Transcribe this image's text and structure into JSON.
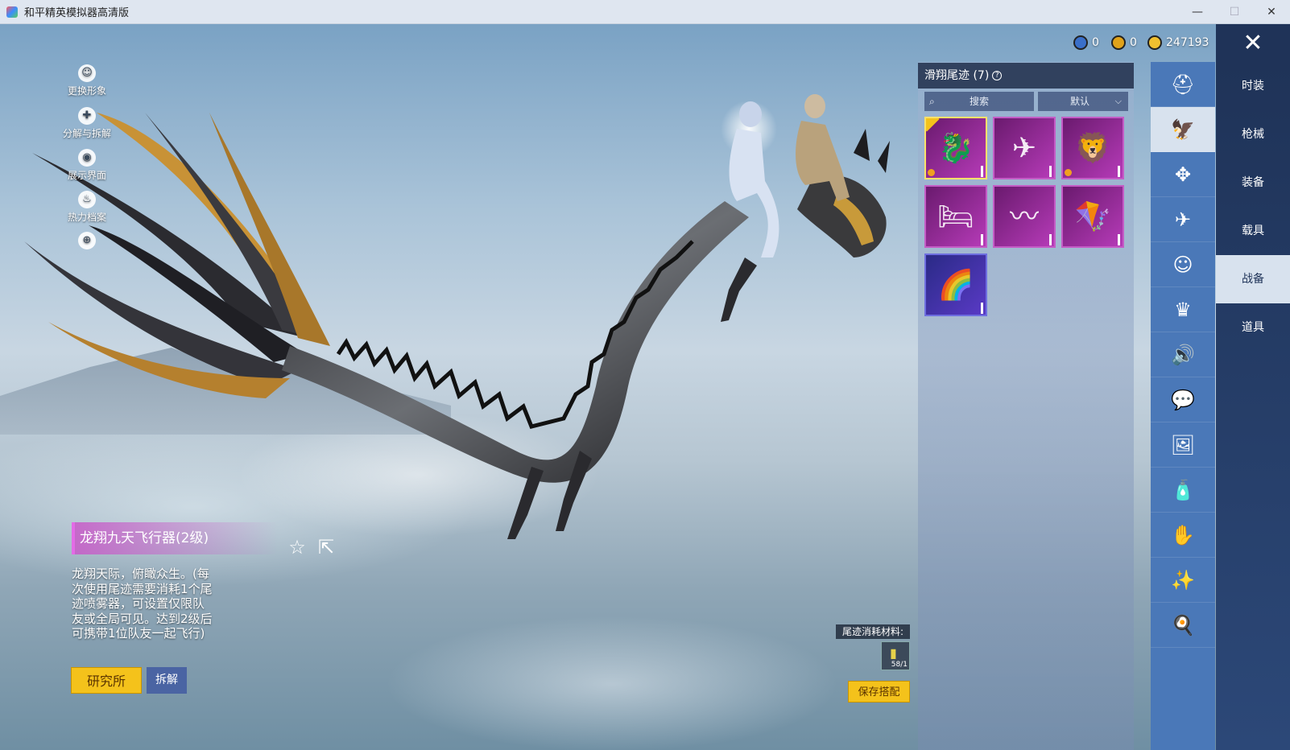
{
  "window": {
    "title": "和平精英模拟器高清版",
    "minimize": "—",
    "maximize": "☐",
    "close": "✕"
  },
  "currency": [
    {
      "icon": "globe-coin-icon",
      "value": "0",
      "color": "#3a6fc9"
    },
    {
      "icon": "a-coin-icon",
      "value": "0",
      "color": "#e0a21a"
    },
    {
      "icon": "gold-coin-icon",
      "value": "247193",
      "color": "#f0c030"
    }
  ],
  "left_tools": [
    {
      "name": "change-avatar",
      "icon": "person-icon",
      "glyph": "☺",
      "label": "更换形象"
    },
    {
      "name": "decompose-exchange",
      "icon": "puzzle-icon",
      "glyph": "✚",
      "label": "分解与拆解"
    },
    {
      "name": "display-interface",
      "icon": "eye-icon",
      "glyph": "◉",
      "label": "展示界面"
    },
    {
      "name": "hot-archive",
      "icon": "flame-icon",
      "glyph": "♨",
      "label": "热力档案"
    },
    {
      "name": "zoom",
      "icon": "zoom-in-icon",
      "glyph": "⊕",
      "label": ""
    }
  ],
  "item": {
    "name": "龙翔九天飞行器(2级)",
    "description": "龙翔天际，俯瞰众生。(每次使用尾迹需要消耗1个尾迹喷雾器，可设置仅限队友或全局可见。达到2级后可携带1位队友一起飞行)",
    "lab_button": "研究所",
    "decompose_button": "拆解",
    "material_label": "尾迹消耗材料:",
    "material_qty": "58/1",
    "save_button": "保存搭配"
  },
  "inventory": {
    "title": "滑翔尾迹 (7)",
    "help": "?",
    "search_placeholder": "搜索",
    "sort_label": "默认",
    "slots": [
      {
        "name": "dragon-glider",
        "glyph": "🐉",
        "selected": true,
        "variant": "purple",
        "mark": true
      },
      {
        "name": "mech-wing-glider",
        "glyph": "✈",
        "selected": false,
        "variant": "purple",
        "mark": false
      },
      {
        "name": "golden-winged-lion",
        "glyph": "🦁",
        "selected": false,
        "variant": "purple",
        "mark": true
      },
      {
        "name": "pink-bed-glider",
        "glyph": "🛏",
        "selected": false,
        "variant": "purple",
        "mark": false
      },
      {
        "name": "white-wing-glider",
        "glyph": "〰",
        "selected": false,
        "variant": "purple",
        "mark": false
      },
      {
        "name": "purple-wing-glider",
        "glyph": "🪁",
        "selected": false,
        "variant": "purple",
        "mark": false
      },
      {
        "name": "rainbow-trail",
        "glyph": "🌈",
        "selected": false,
        "variant": "blue",
        "mark": false
      }
    ]
  },
  "categories": [
    {
      "name": "helmet",
      "glyph": "⛑"
    },
    {
      "name": "glider-trail",
      "glyph": "🦅",
      "active": true
    },
    {
      "name": "drone",
      "glyph": "✥"
    },
    {
      "name": "plane",
      "glyph": "✈"
    },
    {
      "name": "emote",
      "glyph": "☺"
    },
    {
      "name": "avatar-frame",
      "glyph": "♛"
    },
    {
      "name": "sound",
      "glyph": "🔊"
    },
    {
      "name": "chat-bubble",
      "glyph": "💬"
    },
    {
      "name": "gallery",
      "glyph": "🖼"
    },
    {
      "name": "spray",
      "glyph": "🧴"
    },
    {
      "name": "gesture",
      "glyph": "✋"
    },
    {
      "name": "magic-effect",
      "glyph": "✨"
    },
    {
      "name": "pan",
      "glyph": "🍳"
    }
  ],
  "main_tabs": [
    {
      "label": "时装",
      "active": false
    },
    {
      "label": "枪械",
      "active": false
    },
    {
      "label": "装备",
      "active": false
    },
    {
      "label": "载具",
      "active": false
    },
    {
      "label": "战备",
      "active": true
    },
    {
      "label": "道具",
      "active": false
    }
  ]
}
